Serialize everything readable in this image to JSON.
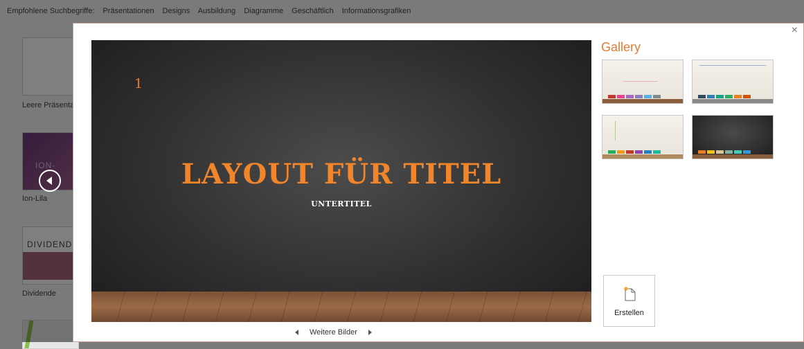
{
  "background": {
    "search_label": "Empfohlene Suchbegriffe:",
    "search_terms": [
      "Präsentationen",
      "Designs",
      "Ausbildung",
      "Diagramme",
      "Geschäftlich",
      "Informationsgrafiken"
    ],
    "templates": [
      {
        "caption": "Leere Präsenta"
      },
      {
        "thumb_text": "ION-",
        "caption": "Ion-Lila"
      },
      {
        "thumb_text": "DIVIDENDE",
        "caption": "Dividende"
      }
    ]
  },
  "dialog": {
    "close_label": "×",
    "slide": {
      "number": "1",
      "title": "LAYOUT FÜR TITEL",
      "subtitle": "UNTERTITEL"
    },
    "more_images": "Weitere Bilder",
    "gallery": {
      "title": "Gallery",
      "variants": [
        {
          "style": "light",
          "swatches": [
            "#c0392b",
            "#e84393",
            "#a569bd",
            "#8e7cc3",
            "#5dade2",
            "#7f8c8d"
          ]
        },
        {
          "style": "light",
          "swatches": [
            "#34495e",
            "#2980b9",
            "#16a085",
            "#27ae60",
            "#e67e22",
            "#d35400"
          ]
        },
        {
          "style": "light",
          "swatches": [
            "#27ae60",
            "#f39c12",
            "#c0392b",
            "#8e44ad",
            "#2980b9",
            "#1abc9c"
          ]
        },
        {
          "style": "dark",
          "swatches": [
            "#e67e22",
            "#f1c40f",
            "#d4c69a",
            "#7fb3a0",
            "#48c9b0",
            "#3498db"
          ]
        }
      ]
    },
    "create_label": "Erstellen"
  },
  "colors": {
    "accent": "#e87a2e",
    "slide_bg": "#303030",
    "floor": "#8a5e3d"
  }
}
